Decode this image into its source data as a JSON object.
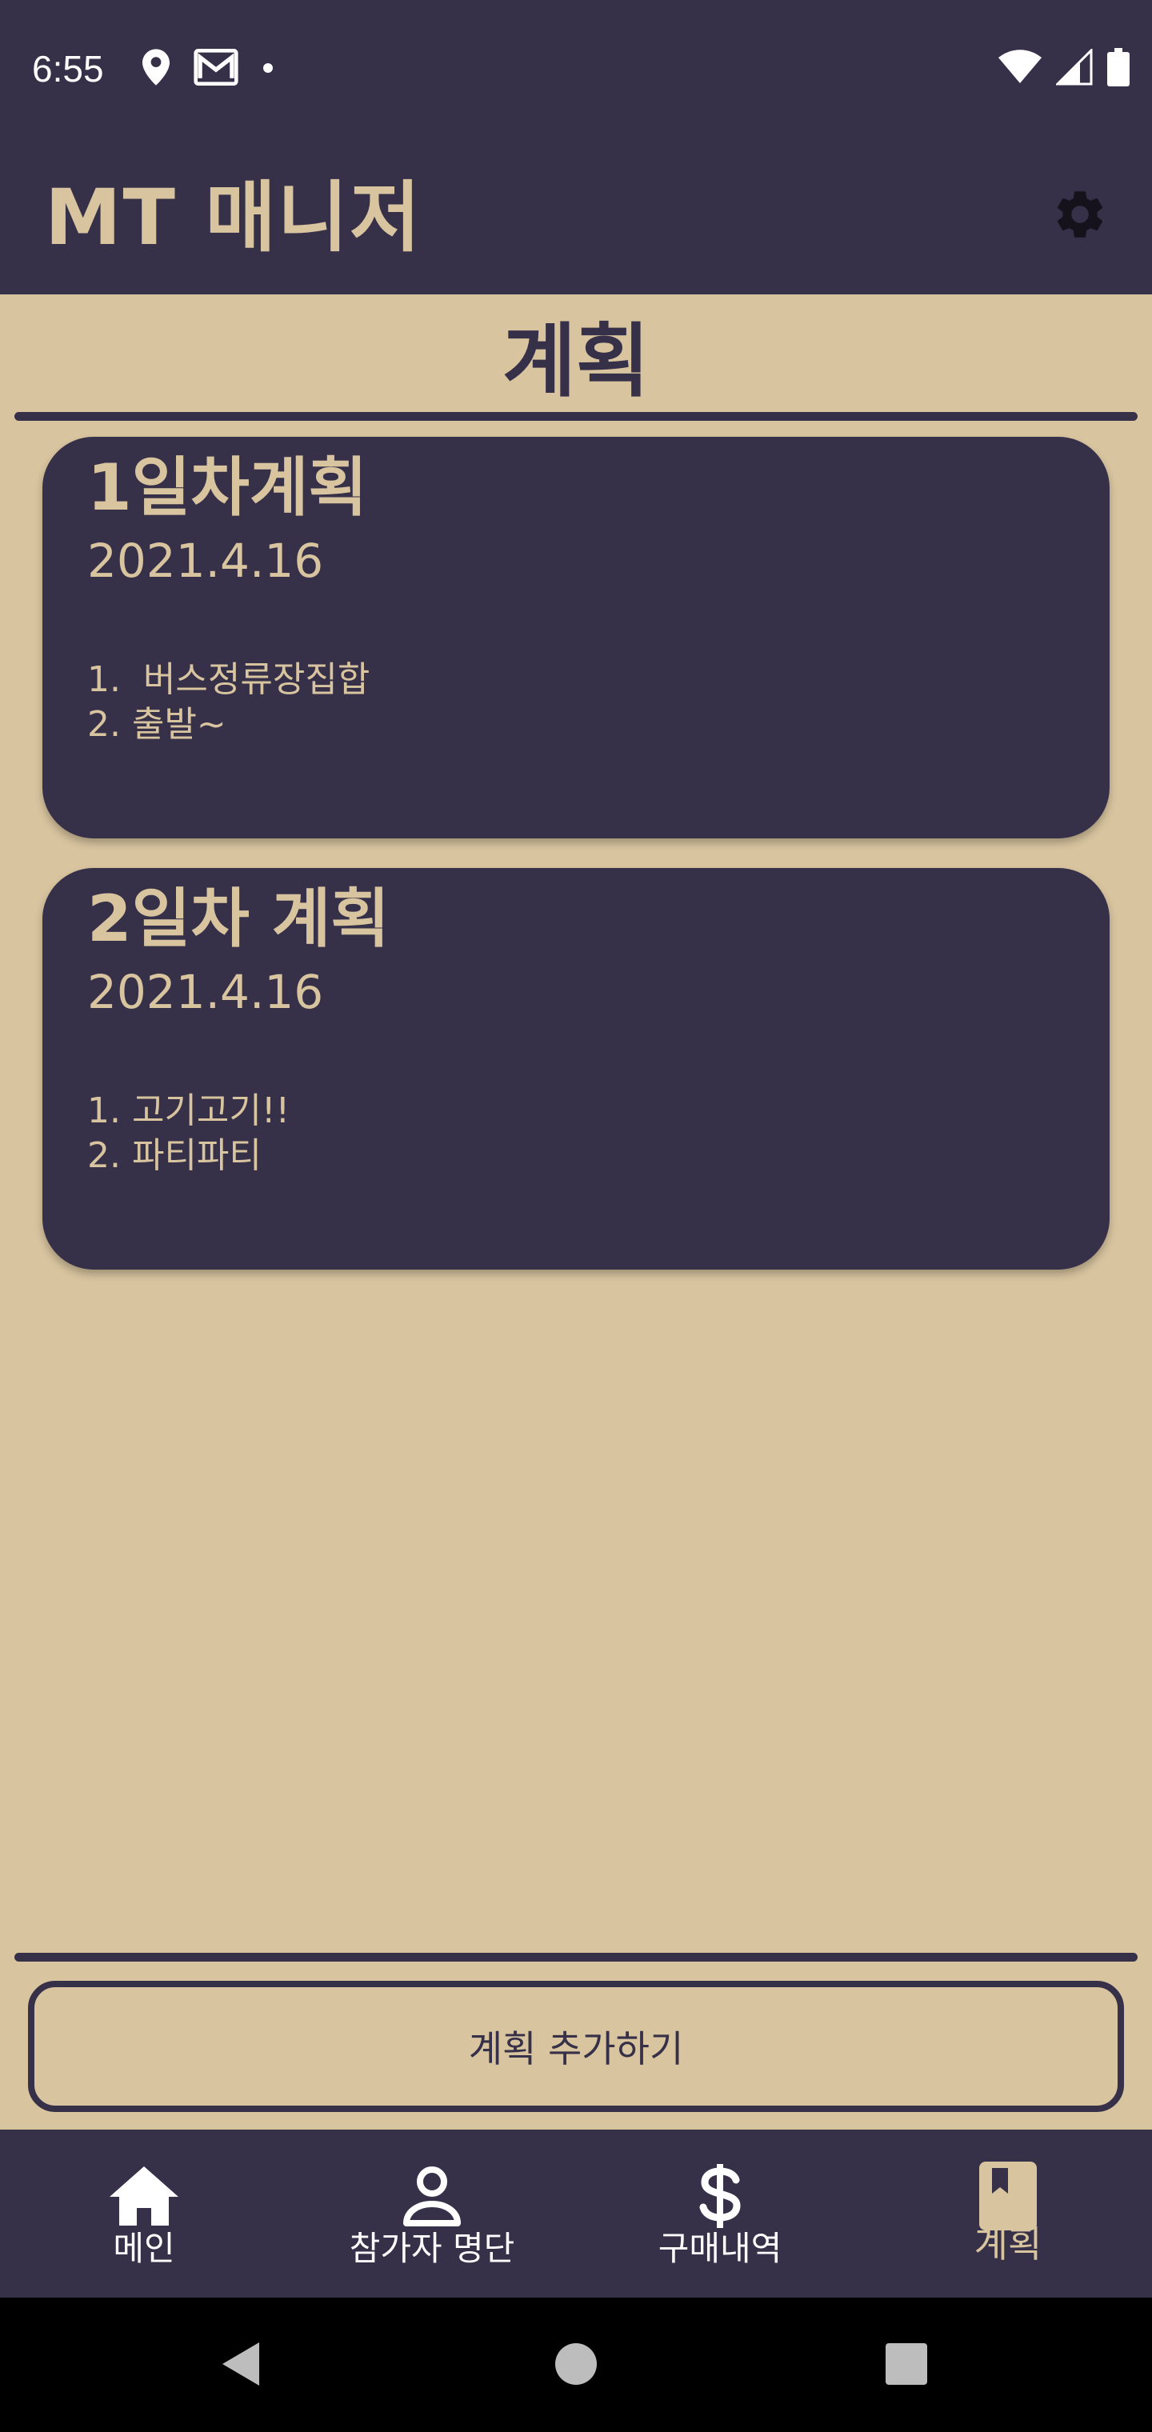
{
  "status_bar": {
    "time": "6:55",
    "left_icons": [
      "location-icon",
      "gmail-icon",
      "dot-icon"
    ],
    "right_icons": [
      "wifi-icon",
      "cell-signal-icon",
      "battery-icon"
    ]
  },
  "app_bar": {
    "title": "MT 매니저",
    "settings_icon": "gear-icon"
  },
  "page": {
    "heading": "계획"
  },
  "plans": [
    {
      "title": "1일차계획",
      "date": "2021.4.16",
      "items": [
        "1.  버스정류장집합",
        "2. 출발~"
      ]
    },
    {
      "title": "2일차 계획",
      "date": "2021.4.16",
      "items": [
        "1. 고기고기!!",
        "2. 파티파티"
      ]
    }
  ],
  "add_button": {
    "label": "계획 추가하기"
  },
  "bottom_nav": {
    "items": [
      {
        "label": "메인",
        "icon": "home-icon",
        "active": false
      },
      {
        "label": "참가자 명단",
        "icon": "person-icon",
        "active": false
      },
      {
        "label": "구매내역",
        "icon": "dollar-icon",
        "active": false
      },
      {
        "label": "계획",
        "icon": "bookmark-book-icon",
        "active": true
      }
    ]
  },
  "system_nav": {
    "buttons": [
      "back-icon",
      "home-circle-icon",
      "recents-icon"
    ]
  },
  "colors": {
    "primary_dark": "#363049",
    "background": "#d8c49f",
    "accent_text": "#d8c49f",
    "white": "#ffffff",
    "system_nav": "#000000"
  }
}
